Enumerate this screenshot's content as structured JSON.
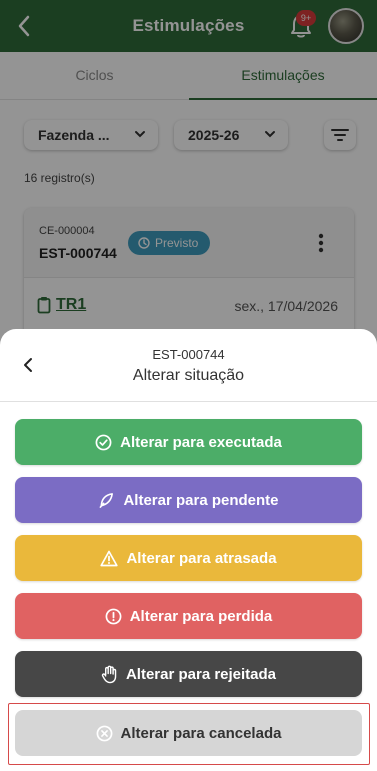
{
  "appbar": {
    "title": "Estimulações",
    "notif_badge": "9+"
  },
  "tabs": [
    {
      "label": "Ciclos"
    },
    {
      "label": "Estimulações",
      "active": true
    }
  ],
  "filters": {
    "farm": "Fazenda ...",
    "season": "2025-26"
  },
  "record_count": "16 registro(s)",
  "card": {
    "code1": "CE-000004",
    "code2": "EST-000744",
    "status": "Previsto",
    "tr": "TR1",
    "date": "sex., 17/04/2026"
  },
  "sheet": {
    "title": "EST-000744",
    "subtitle": "Alterar situação",
    "actions": [
      {
        "label": "Alterar para executada",
        "icon": "check-circle-icon",
        "color": "#4cad68"
      },
      {
        "label": "Alterar para pendente",
        "icon": "feather-icon",
        "color": "#7b6cc4"
      },
      {
        "label": "Alterar para atrasada",
        "icon": "warning-triangle-icon",
        "color": "#eab83b"
      },
      {
        "label": "Alterar para perdida",
        "icon": "exclamation-circle-icon",
        "color": "#e06262"
      },
      {
        "label": "Alterar para rejeitada",
        "icon": "hand-icon",
        "color": "#474747"
      },
      {
        "label": "Alterar para cancelada",
        "icon": "x-circle-icon",
        "color": "#d6d6d6"
      }
    ]
  },
  "colors": {
    "primary": "#2f6b3a",
    "status_chip": "#3f9bbd",
    "highlight": "#d64a4a"
  }
}
